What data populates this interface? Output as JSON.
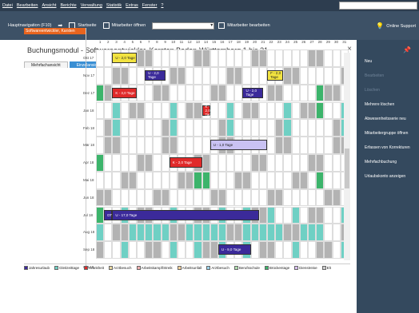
{
  "menubar": {
    "items": [
      "Datei",
      "Bearbeiten",
      "Ansicht",
      "Berichte",
      "Verwaltung",
      "Statistik",
      "Extras",
      "Fenster",
      "?"
    ]
  },
  "toolbar": {
    "nav_label": "Hauptnavigation (F10)",
    "start_label": "Startseite",
    "open_label": "Mitarbeiter öffnen",
    "edit_label": "Mitarbeiter bearbeiten",
    "support_label": "Online Support"
  },
  "window": {
    "title": "Buchungsmodul - Softwareentwickler, Karsten  Baden-Württemberg   1 bis 31"
  },
  "tabs": [
    "Mehrfachansicht",
    "Einzelansicht"
  ],
  "employee": "Softwareentwickler, Karsten",
  "days": [
    "1",
    "2",
    "3",
    "4",
    "5",
    "6",
    "7",
    "8",
    "9",
    "10",
    "11",
    "12",
    "13",
    "14",
    "15",
    "16",
    "17",
    "18",
    "19",
    "20",
    "21",
    "22",
    "23",
    "24",
    "25",
    "26",
    "27",
    "28",
    "29",
    "30",
    "31"
  ],
  "months": [
    "Okt 17",
    "Nov 17",
    "Dez 17",
    "Jan 18",
    "Feb 18",
    "Mär 18",
    "Apr 18",
    "Mai 18",
    "Jun 18",
    "Jul 18",
    "Aug 18",
    "Sep 18",
    "Okt 18"
  ],
  "bookings": [
    {
      "label": "U - 2,0 Tage"
    },
    {
      "label": "U - 2,0 Tage"
    },
    {
      "label": "F - 2,0 Tage"
    },
    {
      "label": "K - 3,0 Tage"
    },
    {
      "label": "U - 2,0 Tage"
    },
    {
      "label": "K - 2,0 Tage"
    },
    {
      "label": "U - 1,0 Tage"
    },
    {
      "label": "K - 2,0 Tage"
    },
    {
      "label": "DT"
    },
    {
      "label": "U - 17,0 Tage"
    },
    {
      "label": "U - 9,0 Tage"
    }
  ],
  "legend": [
    "Jahresurlaub",
    "Gleitzeittage",
    "Krankheit",
    "Arztbesuch",
    "Arbeitskampf/Streik",
    "Arbeitsunfall",
    "Arztbesuch",
    "Berufsschule",
    "Brückentage",
    "Dienstreise",
    "Elt"
  ],
  "sidebar": {
    "items": [
      "Neu",
      "Bearbeiten",
      "Löschen",
      "Mehrere löschen",
      "Abwesenheitsserie neu",
      "Mitarbeitergruppe öffnen",
      "Erfassen von Korrekturen",
      "Mehrfachbuchung",
      "Urlaubskonto anzeigen"
    ]
  },
  "colors": {
    "holiday_weekend": "#b3b3b3",
    "urlaub": "#3b2a9a",
    "krank": "#e02a2a",
    "gleitzeit": "#6fd0c4",
    "frei": "#f2e340",
    "green": "#3cb46b"
  }
}
